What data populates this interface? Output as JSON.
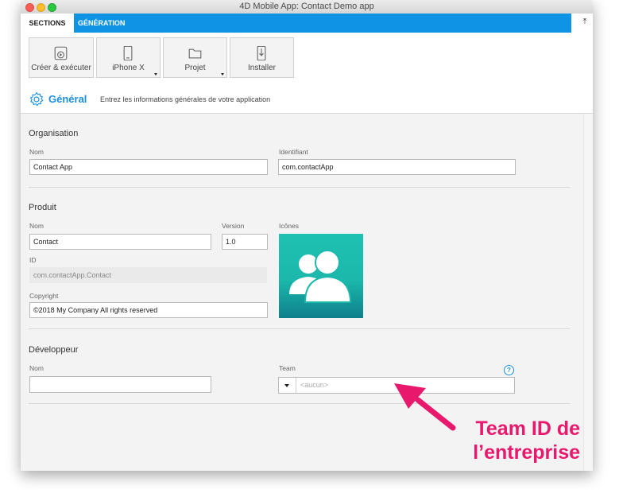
{
  "window": {
    "title": "4D Mobile App: Contact Demo app"
  },
  "tabs": [
    {
      "label": "SECTIONS",
      "active": false
    },
    {
      "label": "GÉNÉRATION",
      "active": true
    }
  ],
  "toolbar": {
    "buttons": [
      {
        "label": "Créer & exécuter",
        "icon": "play-icon"
      },
      {
        "label": "iPhone X",
        "icon": "phone-icon"
      },
      {
        "label": "Projet",
        "icon": "folder-icon"
      },
      {
        "label": "Installer",
        "icon": "install-icon"
      }
    ]
  },
  "section": {
    "title": "Général",
    "description": "Entrez les informations générales de votre application"
  },
  "organisation": {
    "title": "Organisation",
    "name_label": "Nom",
    "name_value": "Contact App",
    "id_label": "Identifiant",
    "id_value": "com.contactApp"
  },
  "produit": {
    "title": "Produit",
    "name_label": "Nom",
    "name_value": "Contact",
    "version_label": "Version",
    "version_value": "1.0",
    "icons_label": "Icônes",
    "id_label": "ID",
    "id_value": "com.contactApp.Contact",
    "copyright_label": "Copyright",
    "copyright_value": "©2018 My Company All rights reserved"
  },
  "developpeur": {
    "title": "Développeur",
    "name_label": "Nom",
    "name_value": "",
    "team_label": "Team",
    "team_placeholder": "<aucun>",
    "help_label": "?"
  },
  "annotation": {
    "line1": "Team ID de",
    "line2": "l’entreprise",
    "color": "#e8196c"
  },
  "colors": {
    "accent": "#0f94e5",
    "title_blue": "#1a8fe0",
    "app_icon": "#1bb8ab"
  }
}
